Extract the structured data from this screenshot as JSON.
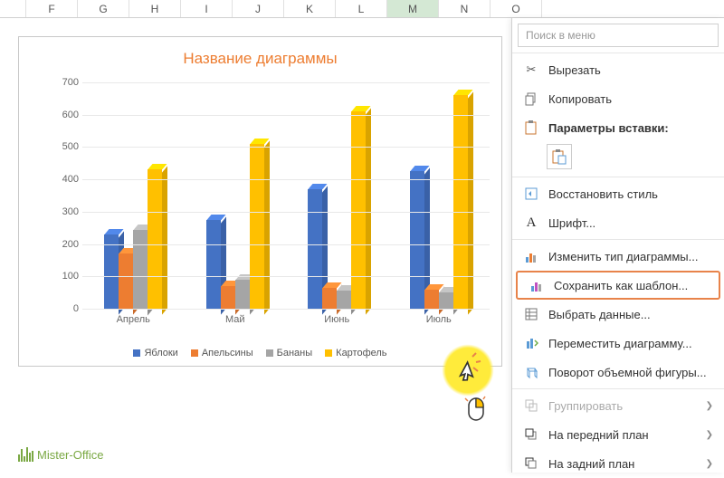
{
  "columns": [
    "",
    "F",
    "G",
    "H",
    "I",
    "J",
    "K",
    "L",
    "M",
    "N",
    "O"
  ],
  "selected_column_index": 8,
  "chart": {
    "title": "Название диаграммы"
  },
  "chart_data": {
    "type": "bar",
    "title": "Название диаграммы",
    "categories": [
      "Апрель",
      "Май",
      "Июнь",
      "Июль"
    ],
    "series": [
      {
        "name": "Яблоки",
        "color": "#4472c4",
        "values": [
          230,
          275,
          370,
          425
        ]
      },
      {
        "name": "Апельсины",
        "color": "#ed7d31",
        "values": [
          170,
          70,
          65,
          60
        ]
      },
      {
        "name": "Бананы",
        "color": "#a5a5a5",
        "values": [
          245,
          90,
          55,
          50
        ]
      },
      {
        "name": "Картофель",
        "color": "#ffc000",
        "values": [
          430,
          510,
          610,
          660
        ]
      }
    ],
    "ylabel": "",
    "xlabel": "",
    "ylim": [
      0,
      700
    ],
    "yticks": [
      0,
      100,
      200,
      300,
      400,
      500,
      600,
      700
    ]
  },
  "context_menu": {
    "search_placeholder": "Поиск в меню",
    "cut": "Вырезать",
    "copy": "Копировать",
    "paste_options": "Параметры вставки:",
    "reset_style": "Восстановить стиль",
    "font": "Шрифт...",
    "change_chart_type": "Изменить тип диаграммы...",
    "save_as_template": "Сохранить как шаблон...",
    "select_data": "Выбрать данные...",
    "move_chart": "Переместить диаграмму...",
    "rotate_3d": "Поворот объемной фигуры...",
    "group": "Группировать",
    "bring_front": "На передний план",
    "send_back": "На задний план"
  },
  "logo_text": "Mister-Office"
}
